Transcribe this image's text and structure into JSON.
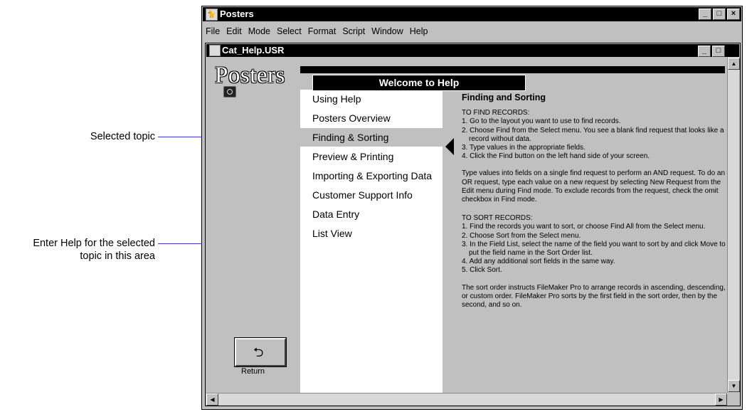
{
  "callouts": {
    "selected_topic": "Selected topic",
    "enter_help_line1": "Enter Help for the selected",
    "enter_help_line2": "topic in this area"
  },
  "app": {
    "title": "Posters",
    "menu": [
      "File",
      "Edit",
      "Mode",
      "Select",
      "Format",
      "Script",
      "Window",
      "Help"
    ]
  },
  "document": {
    "title": "Cat_Help.USR",
    "logo": "Posters",
    "welcome": "Welcome to Help",
    "topics": [
      "Using Help",
      "Posters Overview",
      "Finding & Sorting",
      "Preview & Printing",
      "Importing & Exporting Data",
      "Customer Support Info",
      "Data Entry",
      "List View"
    ],
    "selected_topic_index": 2,
    "help": {
      "heading": "Finding and Sorting",
      "find_title": "TO FIND RECORDS:",
      "find_steps": [
        "1.  Go to the layout you want to use to find records.",
        "2.  Choose Find from the Select menu. You see a blank find request that looks like a record without data.",
        "3.  Type values in the appropriate fields.",
        "4.  Click the Find button on the left hand side of your screen."
      ],
      "and_or_text": "Type values into fields on a single find request to perform an AND request. To do an OR request, type each value on a new request by selecting New Request from the Edit menu during Find mode.  To exclude records from the request, check the omit checkbox  in Find mode.",
      "sort_title": "TO SORT RECORDS:",
      "sort_steps": [
        "1.  Find the records you want to sort, or choose Find All from the Select menu.",
        "2.  Choose Sort from the Select menu.",
        "3.  In the Field List, select the name of the field you want to sort by and click Move to put the field name in the Sort Order list.",
        "4.  Add any additional sort fields in the same way.",
        "5.  Click Sort."
      ],
      "sort_order_text": "The sort order instructs FileMaker Pro to arrange records in ascending, descending, or custom order. FileMaker Pro sorts by the first field in the sort order, then by  the second, and so on."
    },
    "return_label": "Return"
  }
}
